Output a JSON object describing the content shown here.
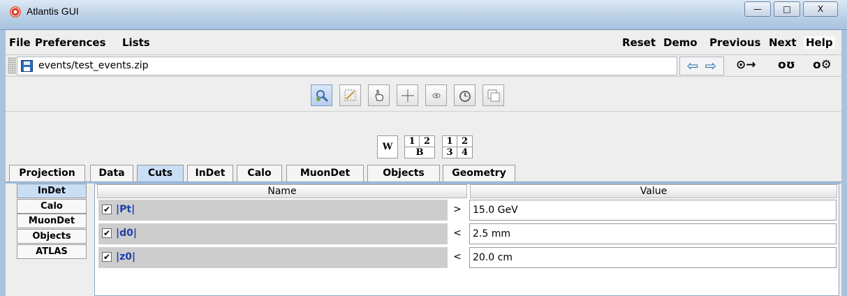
{
  "window": {
    "title": "Atlantis GUI",
    "minimize_glyph": "—",
    "maximize_glyph": "□",
    "close_glyph": "X"
  },
  "menubar": {
    "left": [
      "File",
      "Preferences",
      "Lists"
    ],
    "right": [
      "Reset",
      "Demo",
      "Previous",
      "Next",
      "Help"
    ]
  },
  "filebar": {
    "path": "events/test_events.zip",
    "prev_glyph": "⇦",
    "next_glyph": "⇨",
    "tools": [
      "⊙→",
      "oʊ",
      "o⚙"
    ]
  },
  "toolbar": {
    "tools": [
      "zoom-rotate",
      "rubberband",
      "pick",
      "crosshair",
      "fisheye",
      "clock",
      "synch"
    ]
  },
  "window_controls": {
    "single": "W",
    "grid_2b": [
      "1",
      "2",
      "B"
    ],
    "grid_4": [
      "1",
      "2",
      "3",
      "4"
    ]
  },
  "tabs": [
    "Projection",
    "Data",
    "Cuts",
    "InDet",
    "Calo",
    "MuonDet",
    "Objects",
    "Geometry"
  ],
  "selected_tab": "Cuts",
  "side_tabs": [
    "InDet",
    "Calo",
    "MuonDet",
    "Objects",
    "ATLAS"
  ],
  "selected_side_tab": "InDet",
  "table": {
    "columns": [
      "Name",
      "Value"
    ],
    "rows": [
      {
        "name": "|Pt|",
        "op": ">",
        "value": "15.0 GeV",
        "checked": "✔"
      },
      {
        "name": "|d0|",
        "op": "<",
        "value": "2.5 mm",
        "checked": "✔"
      },
      {
        "name": "|z0|",
        "op": "<",
        "value": "20.0 cm",
        "checked": "✔"
      }
    ]
  }
}
